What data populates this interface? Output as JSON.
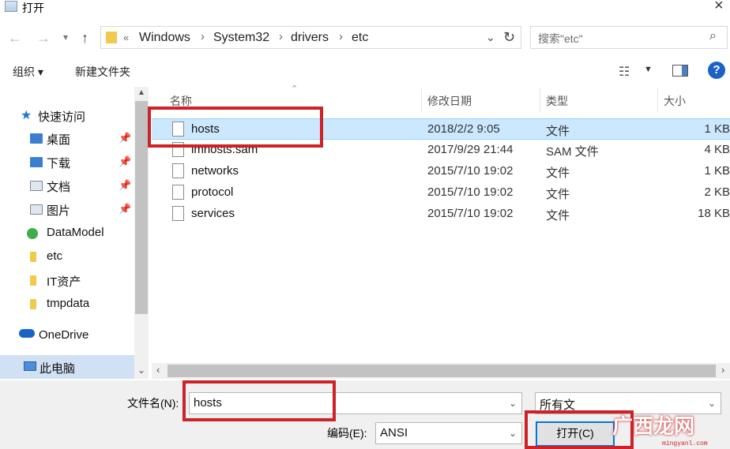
{
  "window": {
    "title": "打开"
  },
  "address": {
    "overflow": "«",
    "crumbs": [
      "Windows",
      "System32",
      "drivers",
      "etc"
    ],
    "search_placeholder": "搜索\"etc\""
  },
  "toolbar": {
    "organize": "组织 ▾",
    "new_folder": "新建文件夹",
    "help": "?"
  },
  "nav": {
    "quick_access": "快速访问",
    "items": [
      {
        "label": "桌面",
        "pinned": true
      },
      {
        "label": "下载",
        "pinned": true
      },
      {
        "label": "文档",
        "pinned": true
      },
      {
        "label": "图片",
        "pinned": true
      },
      {
        "label": "DataModel",
        "pinned": false
      },
      {
        "label": "etc",
        "pinned": false
      },
      {
        "label": "IT资产",
        "pinned": false
      },
      {
        "label": "tmpdata",
        "pinned": false
      }
    ],
    "onedrive": "OneDrive",
    "this_pc": "此电脑"
  },
  "columns": {
    "name": "名称",
    "modified": "修改日期",
    "type": "类型",
    "size": "大小"
  },
  "files": [
    {
      "name": "hosts",
      "modified": "2018/2/2 9:05",
      "type": "文件",
      "size": "1 KB",
      "selected": true
    },
    {
      "name": "lmhosts.sam",
      "modified": "2017/9/29 21:44",
      "type": "SAM 文件",
      "size": "4 KB",
      "selected": false
    },
    {
      "name": "networks",
      "modified": "2015/7/10 19:02",
      "type": "文件",
      "size": "1 KB",
      "selected": false
    },
    {
      "name": "protocol",
      "modified": "2015/7/10 19:02",
      "type": "文件",
      "size": "2 KB",
      "selected": false
    },
    {
      "name": "services",
      "modified": "2015/7/10 19:02",
      "type": "文件",
      "size": "18 KB",
      "selected": false
    }
  ],
  "bottom": {
    "filename_label": "文件名(N):",
    "filename_value": "hosts",
    "filetype_value": "所有文",
    "encoding_label": "编码(E):",
    "encoding_value": "ANSI",
    "open_button": "打开(C)"
  },
  "watermark": {
    "text": "广西龙网",
    "url": "mingyanl.com"
  },
  "colors": {
    "accent": "#0078d7",
    "selection": "#cce8ff",
    "highlight_box": "#cc2228",
    "help_blue": "#1b62c4"
  }
}
